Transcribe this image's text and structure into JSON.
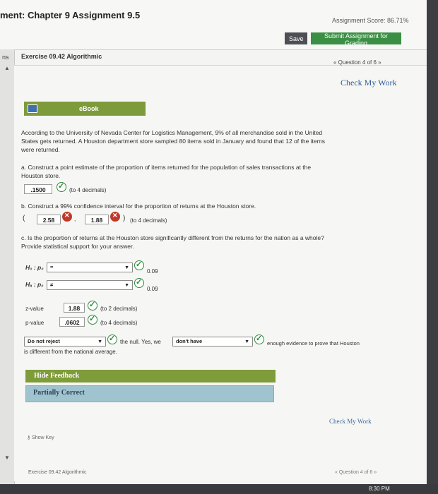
{
  "header": {
    "title": "ment: Chapter 9 Assignment 9.5",
    "assignment_score": "Assignment Score: 86.71%",
    "save_label": "Save",
    "submit_label": "Submit Assignment for Grading"
  },
  "sidebar": {
    "label": "ns"
  },
  "exercise": {
    "label": "Exercise 09.42 Algorithmic",
    "question_nav": "« Question 4 of 6 »",
    "check_my_work": "Check My Work"
  },
  "ebook": {
    "label": "eBook"
  },
  "problem": {
    "line1": "According to the University of Nevada Center for Logistics Management, 9% of all merchandise sold in the United",
    "line2": "States gets returned. A Houston department store sampled 80 items sold in January and found that 12 of the items",
    "line3": "were returned."
  },
  "part_a": {
    "line1": "a. Construct a point estimate of the proportion of items returned for the population of sales transactions at the",
    "line2": "Houston store.",
    "answer": ".1500",
    "note": "(to 4 decimals)"
  },
  "part_b": {
    "question": "b. Construct a 99% confidence interval for the proportion of returns at the Houston store.",
    "open_paren": "(",
    "lower": "2.58",
    "comma": ",",
    "upper": "1.88",
    "close_paren": ")",
    "note": "(to 4 decimals)"
  },
  "part_c": {
    "line1": "c. Is the proportion of returns at the Houston store significantly different from the returns for the nation as a whole?",
    "line2": "Provide statistical support for your answer.",
    "h0_label": "H₀ : p₀",
    "h0_select": "=",
    "h0_value": "0.09",
    "ha_label": "Hₐ : p₀",
    "ha_select": "≠",
    "ha_value": "0.09",
    "z_label": "z-value",
    "z_value": "1.88",
    "z_note": "(to 2 decimals)",
    "p_label": "p-value",
    "p_value": ".0602",
    "p_note": "(to 4 decimals)",
    "decision_select": "Do not reject",
    "mid_text": "the null. Yes, we",
    "evidence_select": "don't have",
    "end_text": "enough evidence to prove that Houston",
    "line_end": "is different from the national average."
  },
  "feedback": {
    "hide_label": "Hide Feedback",
    "status": "Partially Correct"
  },
  "bottom": {
    "check_my_work": "Check My Work",
    "key": "Show Key",
    "footer_exercise": "Exercise 09.42 Algorithmic",
    "footer_nav": "« Question 4 of 6 »",
    "clock": "8:30 PM"
  },
  "colors": {
    "ebook_green": "#7e9b3b",
    "submit_green": "#3b8f45",
    "correct_green": "#2d8a3a",
    "wrong_red": "#c0392b",
    "partial_blue": "#9fc3cf",
    "link_blue": "#2f5d9b"
  }
}
